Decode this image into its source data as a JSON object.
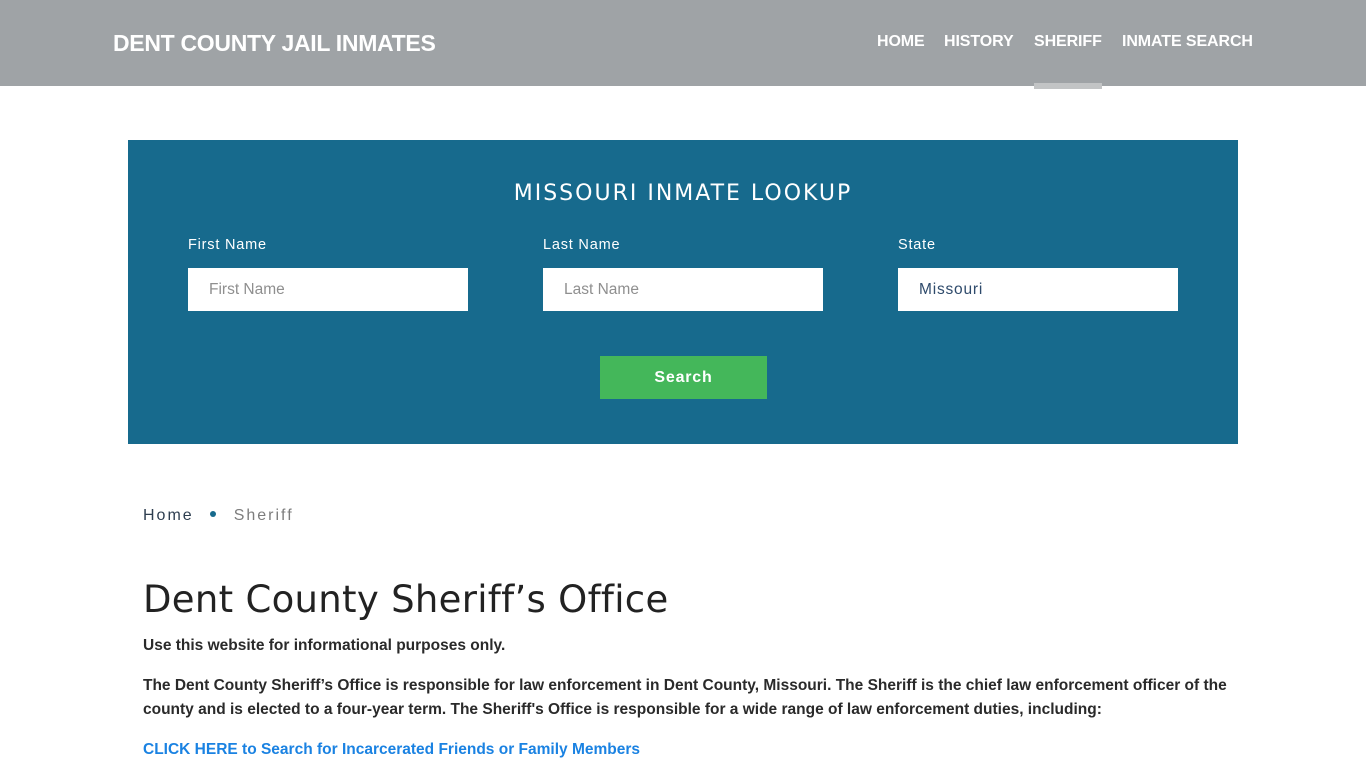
{
  "header": {
    "brand": "DENT COUNTY JAIL INMATES",
    "nav": [
      {
        "label": "HOME",
        "active": false
      },
      {
        "label": "HISTORY",
        "active": false
      },
      {
        "label": "SHERIFF",
        "active": true
      },
      {
        "label": "INMATE SEARCH",
        "active": false
      }
    ]
  },
  "lookup": {
    "title": "MISSOURI INMATE LOOKUP",
    "first_name": {
      "label": "First Name",
      "placeholder": "First Name",
      "value": ""
    },
    "last_name": {
      "label": "Last Name",
      "placeholder": "Last Name",
      "value": ""
    },
    "state": {
      "label": "State",
      "value": "Missouri"
    },
    "search_label": "Search"
  },
  "breadcrumb": {
    "home": "Home",
    "current": "Sheriff"
  },
  "content": {
    "title": "Dent County Sheriff’s Office",
    "paragraphs": [
      "Use this website for informational purposes only.",
      "The Dent County Sheriff’s Office is responsible for law enforcement in Dent County, Missouri. The Sheriff is the chief law enforcement officer of the county and is elected to a four-year term. The Sheriff's Office is responsible for a wide range of law enforcement duties, including:"
    ],
    "cta_link": "CLICK HERE to Search for Incarcerated Friends or Family Members"
  },
  "colors": {
    "header_bg": "#9fa3a6",
    "lookup_bg": "#176a8d",
    "search_button": "#44b75a",
    "link": "#1a82e2"
  }
}
